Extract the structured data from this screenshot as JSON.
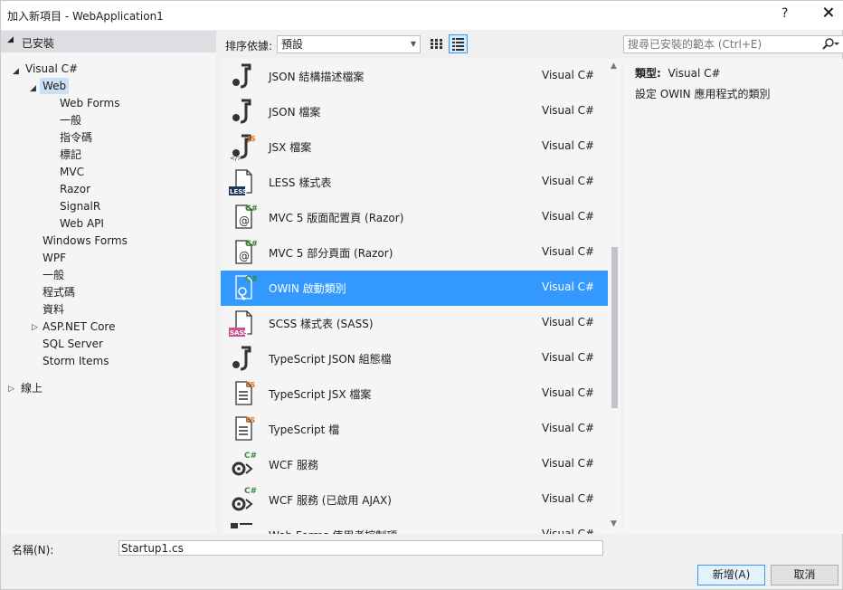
{
  "window": {
    "title": "加入新項目 - WebApplication1",
    "help": "?"
  },
  "tree": {
    "installed": "已安裝",
    "visual_csharp": "Visual C#",
    "web": "Web",
    "web_children": [
      "Web Forms",
      "一般",
      "指令碼",
      "標記",
      "MVC",
      "Razor",
      "SignalR",
      "Web API"
    ],
    "csharp_children": [
      "Windows Forms",
      "WPF",
      "一般",
      "程式碼"
    ],
    "data": "資料",
    "aspnet_core": "ASP.NET Core",
    "sql_server": "SQL Server",
    "storm_items": "Storm Items",
    "online": "線上"
  },
  "toolbar": {
    "sort_label": "排序依據:",
    "sort_value": "預設"
  },
  "search": {
    "placeholder": "搜尋已安裝的範本 (Ctrl+E)"
  },
  "templates": [
    {
      "name": "JSON 結構描述檔案",
      "type": "Visual C#",
      "icon": "json-schema-icon"
    },
    {
      "name": "JSON 檔案",
      "type": "Visual C#",
      "icon": "json-file-icon"
    },
    {
      "name": "JSX 檔案",
      "type": "Visual C#",
      "icon": "jsx-file-icon"
    },
    {
      "name": "LESS 樣式表",
      "type": "Visual C#",
      "icon": "less-stylesheet-icon"
    },
    {
      "name": "MVC 5 版面配置頁 (Razor)",
      "type": "Visual C#",
      "icon": "mvc-layout-icon"
    },
    {
      "name": "MVC 5 部分頁面 (Razor)",
      "type": "Visual C#",
      "icon": "mvc-partial-icon"
    },
    {
      "name": "OWIN 啟動類別",
      "type": "Visual C#",
      "icon": "owin-startup-icon",
      "selected": true
    },
    {
      "name": "SCSS 樣式表 (SASS)",
      "type": "Visual C#",
      "icon": "scss-stylesheet-icon"
    },
    {
      "name": "TypeScript JSON 組態檔",
      "type": "Visual C#",
      "icon": "ts-json-config-icon"
    },
    {
      "name": "TypeScript JSX 檔案",
      "type": "Visual C#",
      "icon": "ts-jsx-file-icon"
    },
    {
      "name": "TypeScript 檔",
      "type": "Visual C#",
      "icon": "typescript-file-icon"
    },
    {
      "name": "WCF 服務",
      "type": "Visual C#",
      "icon": "wcf-service-icon"
    },
    {
      "name": "WCF 服務 (已啟用 AJAX)",
      "type": "Visual C#",
      "icon": "wcf-ajax-service-icon"
    },
    {
      "name": "Web Forms 使用者控制項",
      "type": "Visual C#",
      "icon": "web-forms-control-icon"
    }
  ],
  "details": {
    "type_label": "類型:",
    "type_value": "Visual C#",
    "description": "設定 OWIN 應用程式的類別"
  },
  "footer": {
    "name_label": "名稱(N):",
    "name_value": "Startup1.cs",
    "add_button": "新增(A)",
    "cancel_button": "取消"
  },
  "colors": {
    "accent": "#3399ff",
    "csharp_badge": "#388a34",
    "less_badge": "#1d365d",
    "scss_badge": "#c6538c",
    "ts_badge": "#e8731c",
    "js_badge": "#e8731c"
  }
}
